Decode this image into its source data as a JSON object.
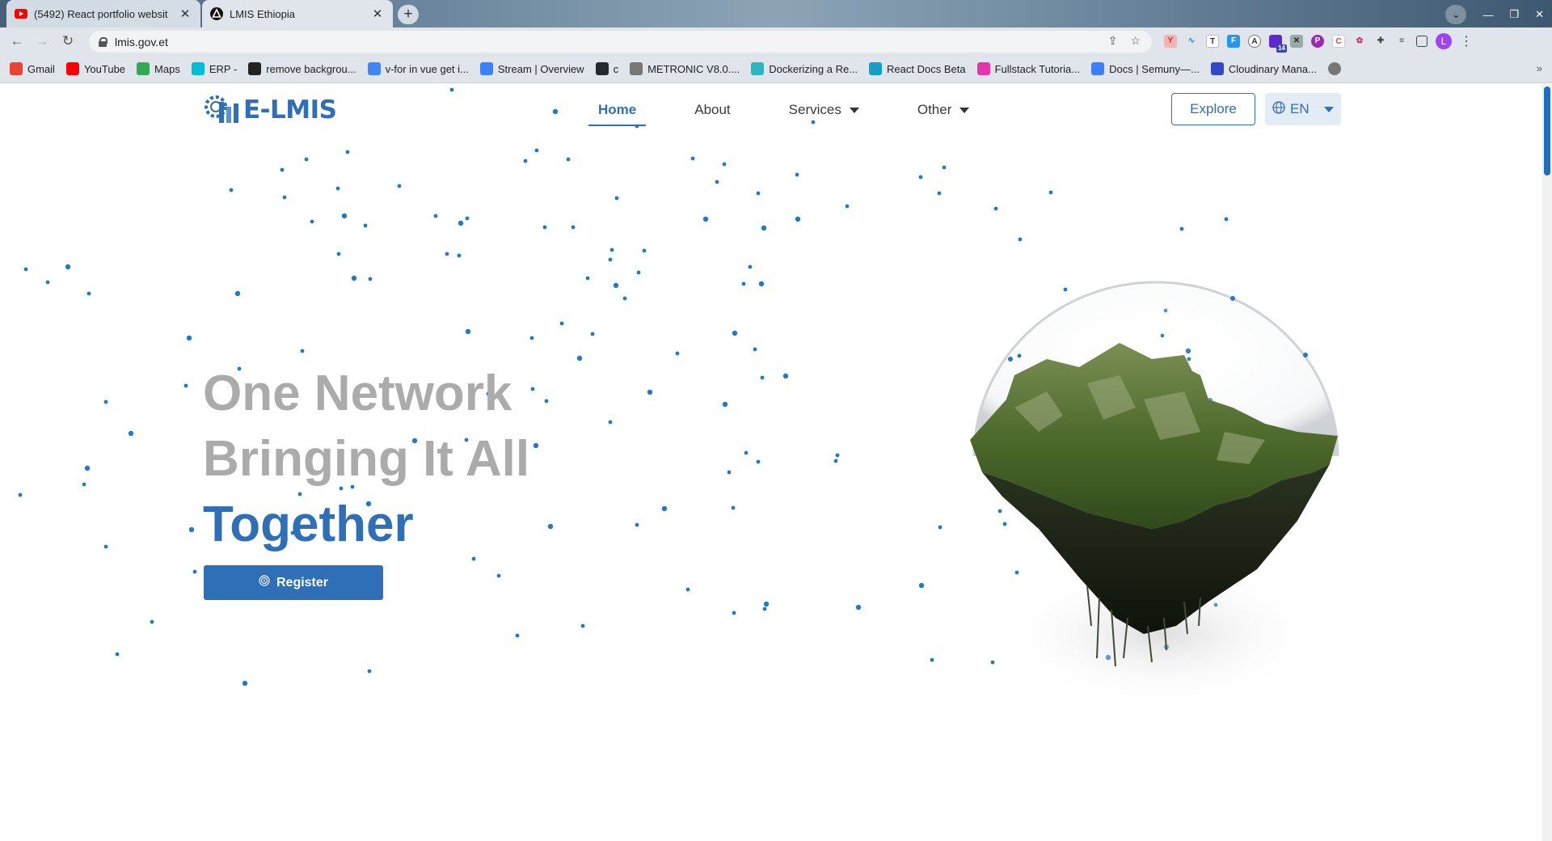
{
  "browser": {
    "tabs": [
      {
        "title": "(5492) React portfolio websit",
        "active": false,
        "icon": "youtube-icon"
      },
      {
        "title": "LMIS Ethiopia",
        "active": true,
        "icon": "site-triangle-icon"
      }
    ],
    "close_glyph": "✕",
    "new_tab_glyph": "+",
    "url": "lmis.gov.et",
    "badge_count": "14",
    "profile_initial": "L",
    "bookmarks": [
      {
        "label": "Gmail",
        "color": "#ea4335"
      },
      {
        "label": "YouTube",
        "color": "#ff0000"
      },
      {
        "label": "Maps",
        "color": "#34a853"
      },
      {
        "label": "ERP -",
        "color": "#00bcd4"
      },
      {
        "label": "remove backgrou...",
        "color": "#222222"
      },
      {
        "label": "v-for in vue get i...",
        "color": "#4285f4"
      },
      {
        "label": "Stream | Overview",
        "color": "#3b82f6"
      },
      {
        "label": "c",
        "color": "#24292f"
      },
      {
        "label": "METRONIC V8.0....",
        "color": "#777777"
      },
      {
        "label": "Dockerizing a Re...",
        "color": "#2bb5c0"
      },
      {
        "label": "React Docs Beta",
        "color": "#149eca"
      },
      {
        "label": "Fullstack Tutoria...",
        "color": "#e535ab"
      },
      {
        "label": "Docs | Semuny—...",
        "color": "#3d7eff"
      },
      {
        "label": "Cloudinary Mana...",
        "color": "#3448c5"
      }
    ]
  },
  "site": {
    "brand": "E-LMIS",
    "brand_color": "#2f6fb7",
    "nav": [
      {
        "label": "Home",
        "active": true
      },
      {
        "label": "About",
        "active": false
      },
      {
        "label": "Services",
        "dropdown": true
      },
      {
        "label": "Other",
        "dropdown": true
      }
    ],
    "explore_label": "Explore",
    "language": "EN",
    "hero": {
      "line1": "One Network",
      "line2": "Bringing It All",
      "line3": "Together",
      "register_label": "Register"
    },
    "dot_color": "#1e7bc4"
  }
}
